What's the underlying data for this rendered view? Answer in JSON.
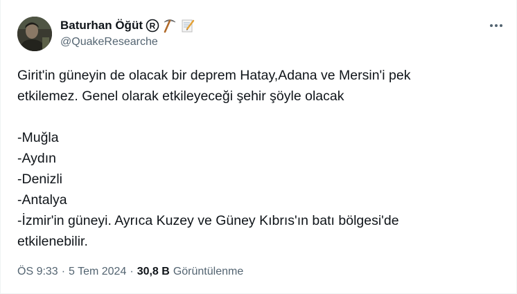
{
  "author": {
    "name": "Baturhan Öğüt",
    "handle": "@QuakeResearche"
  },
  "tweet": {
    "lines": [
      "Girit'in güneyin de olacak bir deprem Hatay,Adana ve Mersin'i pek",
      "etkilemez. Genel olarak etkileyeceği şehir şöyle olacak",
      "",
      "-Muğla",
      "-Aydın",
      "-Denizli",
      "-Antalya",
      "-İzmir'in güneyi. Ayrıca Kuzey ve Güney Kıbrıs'ın batı bölgesi'de",
      "etkilenebilir."
    ]
  },
  "meta": {
    "time": "ÖS 9:33",
    "separator": "·",
    "date": "5 Tem 2024",
    "views_count": "30,8 B",
    "views_label": "Görüntülenme"
  },
  "icons": {
    "registered": "registered-icon",
    "pick": "pickaxe-emoji-icon",
    "memo": "memo-emoji-icon",
    "more": "more-options-icon"
  },
  "colors": {
    "text": "#0f1419",
    "secondary": "#536471"
  }
}
